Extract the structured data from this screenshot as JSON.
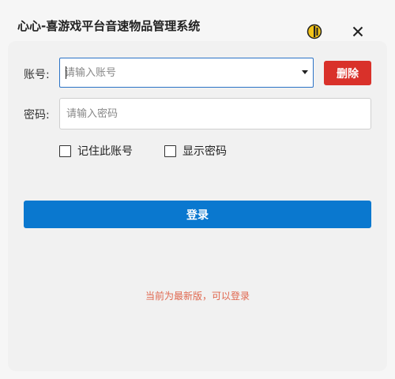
{
  "window": {
    "title": "心心-喜游戏平台音速物品管理系统"
  },
  "account": {
    "label": "账号:",
    "placeholder": "请输入账号",
    "value": "",
    "delete_label": "删除"
  },
  "password": {
    "label": "密码:",
    "placeholder": "请输入密码",
    "value": ""
  },
  "options": {
    "remember_label": "记住此账号",
    "remember_checked": false,
    "show_password_label": "显示密码",
    "show_password_checked": false
  },
  "login_label": "登录",
  "status_text": "当前为最新版，可以登录",
  "colors": {
    "primary": "#0a78cf",
    "danger": "#d9312a",
    "status": "#e0674e",
    "focus_border": "#2b73c6"
  },
  "icons": {
    "skin": "palette-icon",
    "close": "close-icon",
    "dropdown": "chevron-down-icon"
  }
}
